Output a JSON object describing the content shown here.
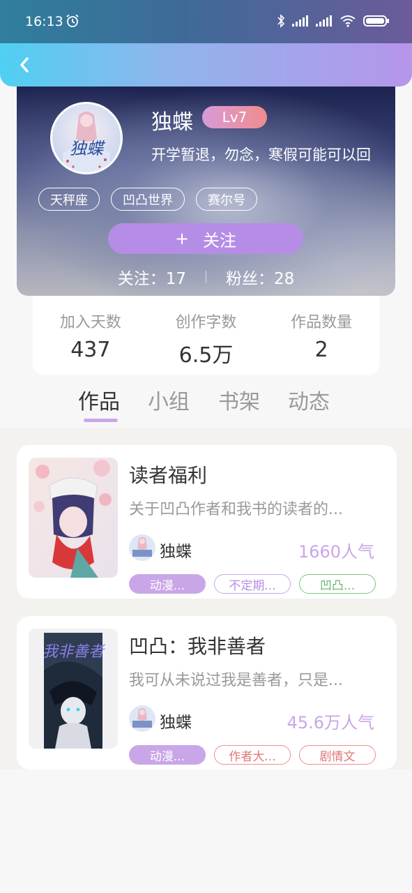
{
  "status_bar": {
    "time": "16:13",
    "icons": [
      "alarm-icon",
      "bluetooth-icon",
      "signal-icon",
      "signal-icon",
      "wifi-icon",
      "battery-icon"
    ]
  },
  "header": {
    "back_icon": "chevron-left-icon",
    "gradient_colors": [
      "#4fd0f2",
      "#b695ea"
    ]
  },
  "profile": {
    "username": "独蝶",
    "level": "Lv7",
    "bio": "开学暂退，勿念，寒假可能可以回",
    "avatar_text": "独蝶",
    "tags": [
      "天秤座",
      "凹凸世界",
      "赛尔号"
    ],
    "follow_button": {
      "icon": "+",
      "label": "关注"
    },
    "following": "关注：17",
    "followers": "粉丝：28"
  },
  "stats": [
    {
      "label": "加入天数",
      "value": "437"
    },
    {
      "label": "创作字数",
      "value": "6.5万"
    },
    {
      "label": "作品数量",
      "value": "2"
    }
  ],
  "tabs": [
    {
      "label": "作品",
      "active": true
    },
    {
      "label": "小组",
      "active": false
    },
    {
      "label": "书架",
      "active": false
    },
    {
      "label": "动态",
      "active": false
    }
  ],
  "books": [
    {
      "title": "读者福利",
      "description": "关于凹凸作者和我书的读者的...",
      "author": "独蝶",
      "popularity": "1660人气",
      "tags": [
        {
          "label": "动漫...",
          "style": "fill"
        },
        {
          "label": "不定期...",
          "style": "purple"
        },
        {
          "label": "凹凸...",
          "style": "green"
        }
      ]
    },
    {
      "title": "凹凸：我非善者",
      "description": "我可从未说过我是善者，只是...",
      "author": "独蝶",
      "popularity": "45.6万人气",
      "cover_text": "我非善者",
      "tags": [
        {
          "label": "动漫...",
          "style": "fill"
        },
        {
          "label": "作者大...",
          "style": "red"
        },
        {
          "label": "剧情文",
          "style": "red"
        }
      ]
    }
  ],
  "colors": {
    "accent_purple": "#b68de6",
    "level_badge": "#f08c8c",
    "popularity": "#c9a6e8"
  }
}
